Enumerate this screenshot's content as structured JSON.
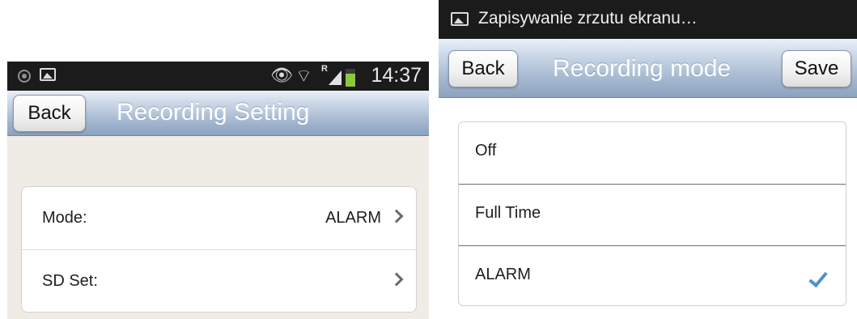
{
  "left_screen": {
    "status_bar": {
      "time": "14:37",
      "signal_letter": "R"
    },
    "header": {
      "back_label": "Back",
      "title": "Recording Setting"
    },
    "settings": [
      {
        "label": "Mode:",
        "value": "ALARM"
      },
      {
        "label": "SD Set:",
        "value": ""
      }
    ]
  },
  "right_screen": {
    "notification": {
      "text": "Zapisywanie zrzutu ekranu…"
    },
    "header": {
      "back_label": "Back",
      "title": "Recording mode",
      "save_label": "Save"
    },
    "options": [
      {
        "label": "Off",
        "selected": false
      },
      {
        "label": "Full Time",
        "selected": false
      },
      {
        "label": "ALARM",
        "selected": true
      }
    ]
  },
  "colors": {
    "accent_check": "#4f8fd4",
    "navbar_gradient_top": "#eaf0f7",
    "navbar_gradient_bottom": "#8ba2be"
  },
  "icons": [
    "screenshot-icon",
    "app-icon",
    "eye-icon",
    "wifi-icon",
    "signal-icon",
    "battery-icon",
    "chevron-right-icon",
    "checkmark-icon"
  ]
}
